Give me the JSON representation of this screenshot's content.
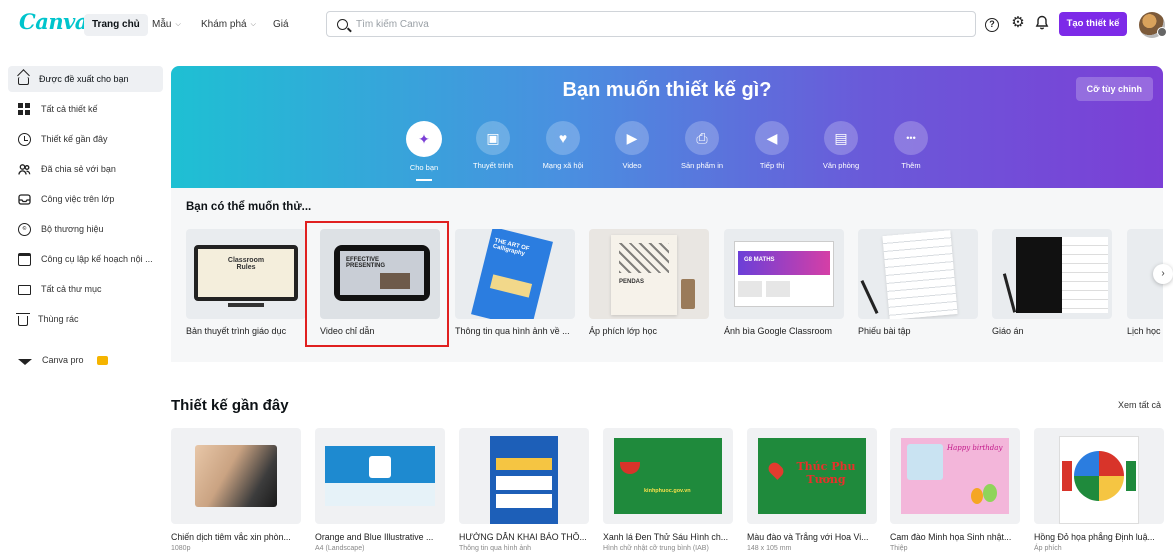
{
  "header": {
    "logo": "Canva",
    "nav": [
      {
        "label": "Trang chủ",
        "active": true
      },
      {
        "label": "Mẫu",
        "dropdown": true
      },
      {
        "label": "Khám phá",
        "dropdown": true
      },
      {
        "label": "Giá",
        "dropdown": false
      }
    ],
    "search_placeholder": "Tìm kiếm Canva",
    "create_label": "Tạo thiết kế",
    "icons": [
      "help-icon",
      "settings-icon",
      "bell-icon"
    ]
  },
  "sidebar": {
    "items": [
      {
        "label": "Được đề xuất cho bạn",
        "icon": "home-icon",
        "active": true
      },
      {
        "label": "Tất cả thiết kế",
        "icon": "grid-icon"
      },
      {
        "label": "Thiết kế gần đây",
        "icon": "clock-icon"
      },
      {
        "label": "Đã chia sẻ với bạn",
        "icon": "people-icon"
      },
      {
        "label": "Công việc trên lớp",
        "icon": "inbox-icon"
      },
      {
        "label": "Bộ thương hiệu",
        "icon": "brand-icon"
      },
      {
        "label": "Công cụ lập kế hoạch nội ...",
        "icon": "calendar-icon"
      },
      {
        "label": "Tất cả thư mục",
        "icon": "folder-icon"
      },
      {
        "label": "Thùng rác",
        "icon": "trash-icon"
      }
    ],
    "pro_label": "Canva pro"
  },
  "hero": {
    "title": "Bạn muốn thiết kế gì?",
    "custom_label": "Cỡ tùy chỉnh",
    "categories": [
      {
        "label": "Cho bạn",
        "icon": "sparkle-icon",
        "glyph": "✦",
        "active": true
      },
      {
        "label": "Thuyết trình",
        "icon": "presentation-icon",
        "glyph": "▣"
      },
      {
        "label": "Mạng xã hội",
        "icon": "heart-icon",
        "glyph": "♥"
      },
      {
        "label": "Video",
        "icon": "video-icon",
        "glyph": "▶"
      },
      {
        "label": "Sản phẩm in",
        "icon": "printer-icon",
        "glyph": "⎙"
      },
      {
        "label": "Tiếp thị",
        "icon": "megaphone-icon",
        "glyph": "◀"
      },
      {
        "label": "Văn phòng",
        "icon": "briefcase-icon",
        "glyph": "▤"
      },
      {
        "label": "Thêm",
        "icon": "more-icon",
        "glyph": "•••"
      }
    ]
  },
  "suggestions": {
    "title": "Bạn có thể muốn thử...",
    "items": [
      {
        "label": "Bản thuyết trình giáo dục",
        "thumb_text": "Classroom Rules"
      },
      {
        "label": "Video chỉ dẫn",
        "thumb_text": "EFFECTIVE PRESENTING"
      },
      {
        "label": "Thông tin qua hình ảnh về ...",
        "thumb_text": "THE ART OF Calligraphy"
      },
      {
        "label": "Áp phích lớp học",
        "thumb_text": "PENDAS"
      },
      {
        "label": "Ảnh bìa Google Classroom",
        "thumb_text": "G8 MATHS"
      },
      {
        "label": "Phiếu bài tập",
        "thumb_text": ""
      },
      {
        "label": "Giáo án",
        "thumb_text": ""
      },
      {
        "label": "Lịch học",
        "thumb_text": ""
      }
    ]
  },
  "recent": {
    "title": "Thiết kế gần đây",
    "see_all": "Xem tất cả",
    "items": [
      {
        "name": "Chiến dịch tiêm vắc xin phòn...",
        "sub": "1080p"
      },
      {
        "name": "Orange and Blue Illustrative ...",
        "sub": "A4 (Landscape)"
      },
      {
        "name": "HƯỚNG DẪN KHAI BÁO THÔ...",
        "sub": "Thông tin qua hình ảnh"
      },
      {
        "name": "Xanh lá Đen Thử Sáu Hình ch...",
        "sub": "Hình chữ nhật cỡ trung bình (IAB)",
        "thumb_text": "kinhphuoc.gov.vn"
      },
      {
        "name": "Màu đào và Trắng với Hoa Vi...",
        "sub": "148 x 105 mm",
        "thumb_text": "Thúc Phu Tương"
      },
      {
        "name": "Cam đào Minh họa Sinh nhật...",
        "sub": "Thiệp",
        "thumb_text": "Happy birthday"
      },
      {
        "name": "Hồng Đỏ họa phẳng Định luậ...",
        "sub": "Áp phích"
      }
    ]
  },
  "colors": {
    "accent": "#7d2ae8",
    "brand": "#00c4cc",
    "highlight": "#e02020"
  }
}
